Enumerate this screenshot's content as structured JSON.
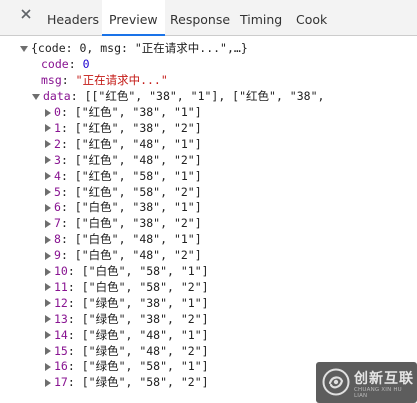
{
  "tabs": {
    "headers": "Headers",
    "preview": "Preview",
    "response": "Response",
    "timing": "Timing",
    "cookies": "Cook"
  },
  "root": {
    "summary": "{code: 0, msg: \"正在请求中...\",…}"
  },
  "code": {
    "key": "code",
    "value": "0"
  },
  "msg": {
    "key": "msg",
    "value": "\"正在请求中...\""
  },
  "data": {
    "key": "data",
    "preview": "[[\"红色\", \"38\", \"1\"], [\"红色\", \"38\","
  },
  "rows": [
    {
      "index": "0",
      "value": "[\"红色\", \"38\", \"1\"]"
    },
    {
      "index": "1",
      "value": "[\"红色\", \"38\", \"2\"]"
    },
    {
      "index": "2",
      "value": "[\"红色\", \"48\", \"1\"]"
    },
    {
      "index": "3",
      "value": "[\"红色\", \"48\", \"2\"]"
    },
    {
      "index": "4",
      "value": "[\"红色\", \"58\", \"1\"]"
    },
    {
      "index": "5",
      "value": "[\"红色\", \"58\", \"2\"]"
    },
    {
      "index": "6",
      "value": "[\"白色\", \"38\", \"1\"]"
    },
    {
      "index": "7",
      "value": "[\"白色\", \"38\", \"2\"]"
    },
    {
      "index": "8",
      "value": "[\"白色\", \"48\", \"1\"]"
    },
    {
      "index": "9",
      "value": "[\"白色\", \"48\", \"2\"]"
    },
    {
      "index": "10",
      "value": "[\"白色\", \"58\", \"1\"]"
    },
    {
      "index": "11",
      "value": "[\"白色\", \"58\", \"2\"]"
    },
    {
      "index": "12",
      "value": "[\"绿色\", \"38\", \"1\"]"
    },
    {
      "index": "13",
      "value": "[\"绿色\", \"38\", \"2\"]"
    },
    {
      "index": "14",
      "value": "[\"绿色\", \"48\", \"1\"]"
    },
    {
      "index": "15",
      "value": "[\"绿色\", \"48\", \"2\"]"
    },
    {
      "index": "16",
      "value": "[\"绿色\", \"58\", \"1\"]"
    },
    {
      "index": "17",
      "value": "[\"绿色\", \"58\", \"2\"]"
    }
  ],
  "watermark": {
    "name": "创新互联",
    "subtitle": "CHUANG XIN HU LIAN"
  },
  "colors": {
    "key": "#881391",
    "number": "#1c00cf",
    "string": "#c41a16",
    "active_tab_underline": "#1a73e8"
  }
}
